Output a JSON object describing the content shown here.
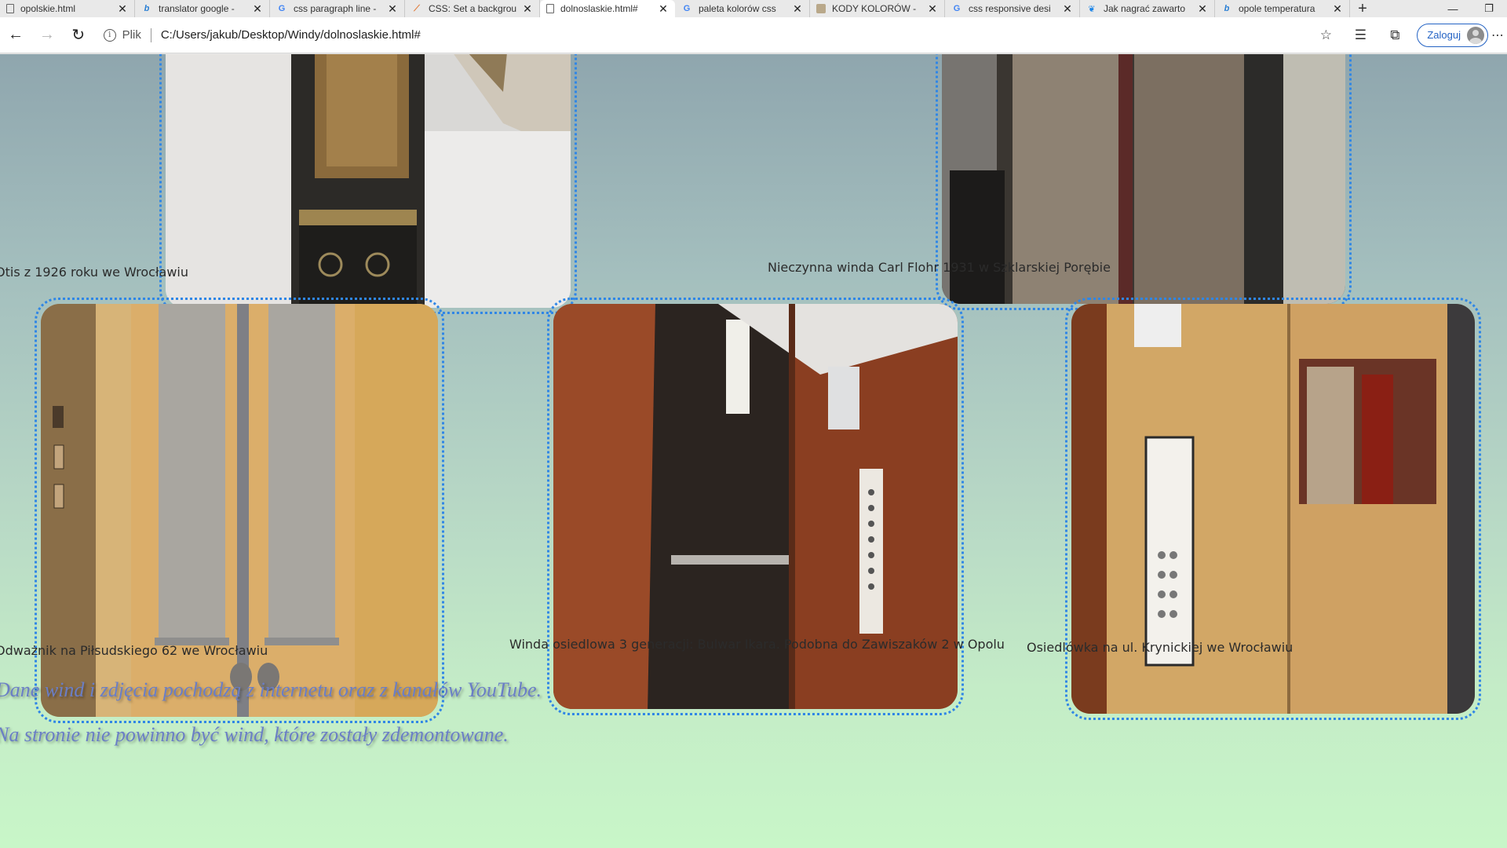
{
  "browser": {
    "tabs": [
      {
        "title": "opolskie.html",
        "icon": "document-icon",
        "active": false
      },
      {
        "title": "translator google -",
        "icon": "bing-icon",
        "active": false
      },
      {
        "title": "css paragraph line -",
        "icon": "google-icon",
        "active": false
      },
      {
        "title": "CSS: Set a backgrou",
        "icon": "css-site-icon",
        "active": false
      },
      {
        "title": "dolnoslaskie.html#",
        "icon": "document-icon",
        "active": true
      },
      {
        "title": "paleta kolorów css",
        "icon": "google-icon",
        "active": false
      },
      {
        "title": "KODY KOLORÓW -",
        "icon": "kody-icon",
        "active": false
      },
      {
        "title": "css responsive desi",
        "icon": "google-icon",
        "active": false
      },
      {
        "title": "Jak nagrać zawarto",
        "icon": "bluesky-icon",
        "active": false
      },
      {
        "title": "opole temperatura",
        "icon": "bing-icon",
        "active": false
      }
    ],
    "address": {
      "scheme_label": "Plik",
      "url": "C:/Users/jakub/Desktop/Windy/dolnoslaskie.html#"
    },
    "login_label": "Zaloguj"
  },
  "page": {
    "colors": {
      "frame_border": "#2f86e6",
      "note_text": "#6a7ec6",
      "caption_text": "#2b2b2b"
    },
    "photos": [
      {
        "caption": "Otis z 1926 roku we Wrocławiu"
      },
      {
        "caption": "Nieczynna winda Carl Flohr 1931 w Szklarskiej Porębie"
      },
      {
        "caption": "Odważnik na Piłsudskiego 62 we Wrocławiu"
      },
      {
        "caption": "Winda osiedlowa 3 generacji: Bulwar Ikara. Podobna do Zawiszaków 2 w Opolu"
      },
      {
        "caption": "Osiedlówka na ul. Krynickiej we Wrocławiu"
      }
    ],
    "notes": [
      "Dane wind i zdjęcia pochodzą z internetu oraz z kanałów YouTube.",
      "Na stronie nie powinno być wind, które zostały zdemontowane."
    ]
  }
}
